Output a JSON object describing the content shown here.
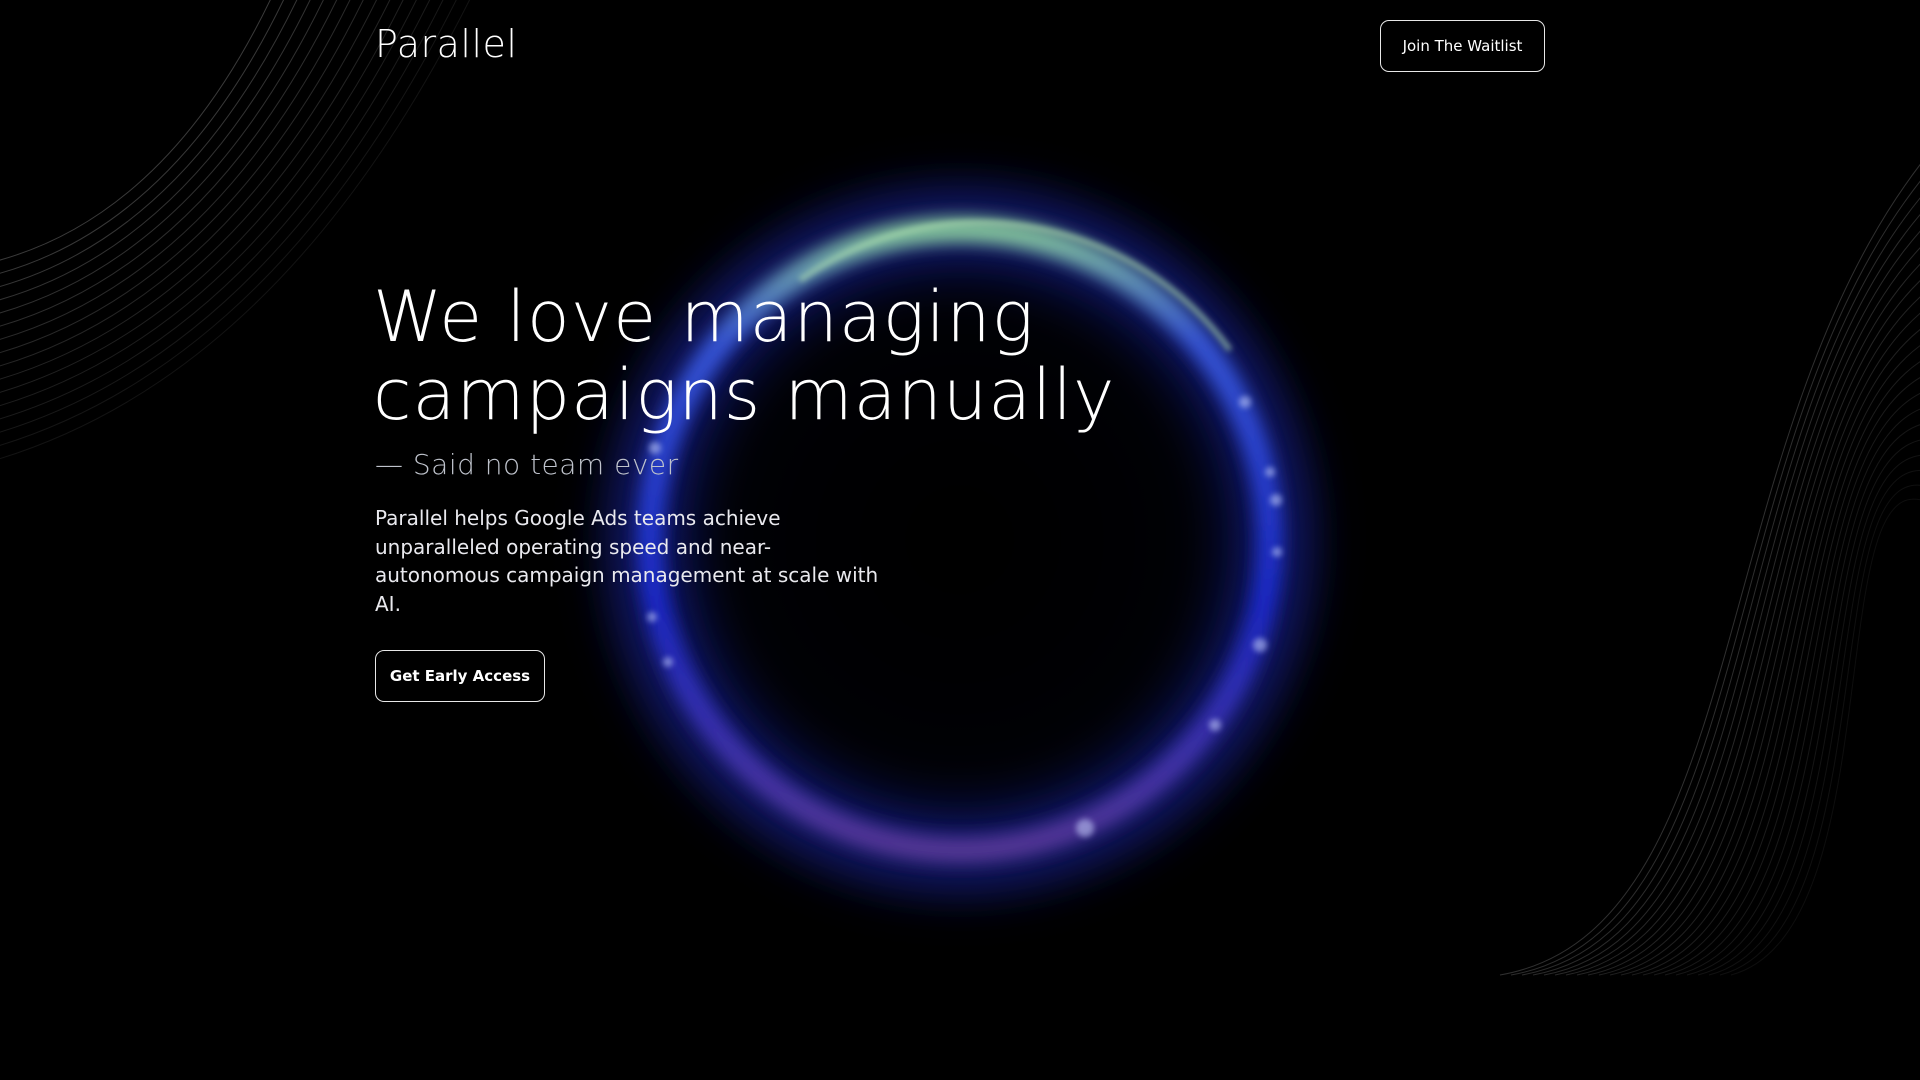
{
  "header": {
    "brand": "Parallel",
    "waitlist_label": "Join The Waitlist"
  },
  "hero": {
    "headline_line1": "We love managing",
    "headline_line2": "campaigns manually",
    "tagline": "— Said no team ever",
    "description": "Parallel helps Google Ads teams achieve unparalleled operating speed and near-autonomous campaign management at scale with AI.",
    "cta_label": "Get Early Access"
  },
  "colors": {
    "background": "#000000",
    "ring_blue": "#1f2fd8",
    "ring_glow_green": "#9ed8a8",
    "ring_purple": "#6a4aa8",
    "line_art": "#6a6a6a"
  }
}
